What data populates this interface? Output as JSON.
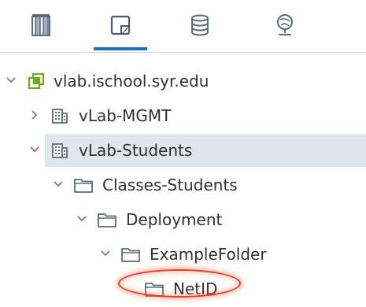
{
  "toolbar": {
    "tabs": [
      {
        "icon": "hosts-and-clusters-icon"
      },
      {
        "icon": "vms-and-templates-icon",
        "active": true
      },
      {
        "icon": "storage-icon"
      },
      {
        "icon": "networking-icon"
      }
    ],
    "accent_color": "#1a73b8"
  },
  "tree": {
    "items": [
      {
        "label": "vlab.ischool.syr.edu",
        "level": 0,
        "expanded": true,
        "icon": "vcenter-icon"
      },
      {
        "label": "vLab-MGMT",
        "level": 1,
        "expanded": false,
        "icon": "datacenter-icon"
      },
      {
        "label": "vLab-Students",
        "level": 1,
        "expanded": true,
        "icon": "datacenter-icon",
        "selected": true
      },
      {
        "label": "Classes-Students",
        "level": 2,
        "expanded": true,
        "icon": "folder-icon"
      },
      {
        "label": "Deployment",
        "level": 3,
        "expanded": true,
        "icon": "folder-icon"
      },
      {
        "label": "ExampleFolder",
        "level": 4,
        "expanded": true,
        "icon": "folder-icon"
      },
      {
        "label": "NetID",
        "level": 5,
        "icon": "folder-icon",
        "highlighted": true
      }
    ],
    "selection_color": "#dfe6ed",
    "highlight_color": "#e53935"
  }
}
